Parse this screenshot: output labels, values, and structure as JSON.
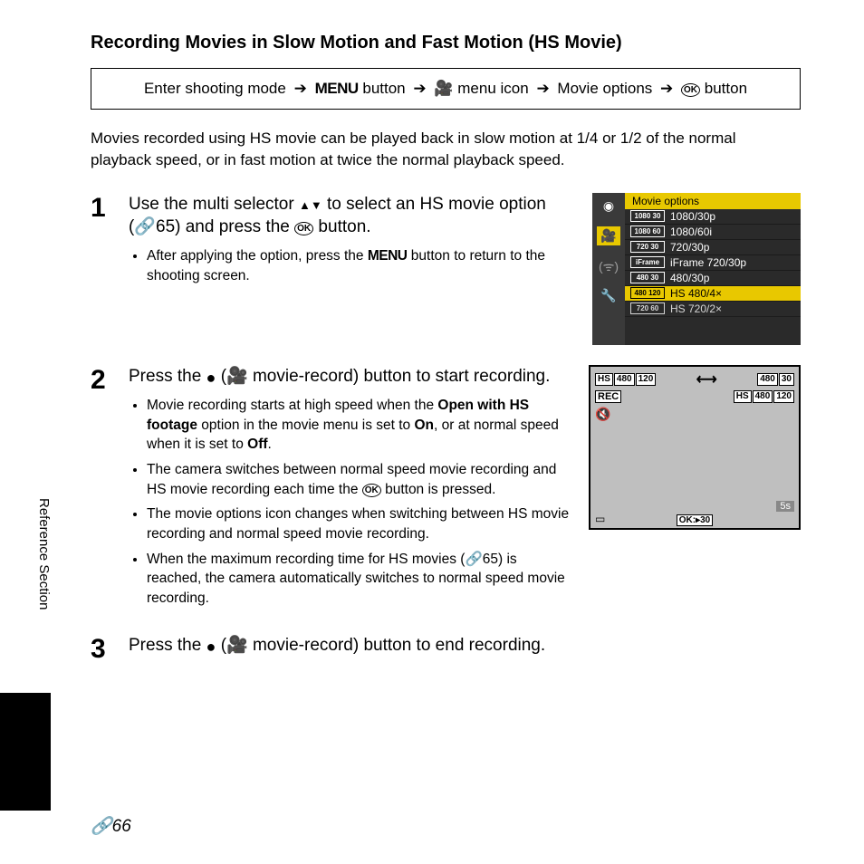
{
  "title": "Recording Movies in Slow Motion and Fast Motion (HS Movie)",
  "nav": {
    "p1": "Enter shooting mode",
    "p2": "MENU",
    "p3_suffix": "button",
    "p4_suffix": "menu icon",
    "p5": "Movie options",
    "p6_suffix": "button"
  },
  "intro": "Movies recorded using HS movie can be played back in slow motion at 1/4 or 1/2 of the normal playback speed, or in fast motion at twice the normal playback speed.",
  "steps": {
    "s1": {
      "num": "1",
      "head_a": "Use the multi selector ",
      "head_b": " to select an HS movie option (",
      "head_c": "65) and press the ",
      "head_d": " button.",
      "bullet1_a": "After applying the option, press the ",
      "bullet1_b": " button to return to the shooting screen."
    },
    "s2": {
      "num": "2",
      "head_a": "Press the ",
      "head_b": " movie-record) button to start recording.",
      "b1_a": "Movie recording starts at high speed when the ",
      "b1_bold1": "Open with HS footage",
      "b1_b": " option in the movie menu is set to ",
      "b1_bold2": "On",
      "b1_c": ", or at normal speed when it is set to ",
      "b1_bold3": "Off",
      "b1_d": ".",
      "b2_a": "The camera switches between normal speed movie recording and HS movie recording each time the ",
      "b2_b": " button is pressed.",
      "b3": "The movie options icon changes when switching between HS movie recording and normal speed movie recording.",
      "b4_a": "When the maximum recording time for HS movies (",
      "b4_b": "65) is reached, the camera automatically switches to normal speed movie recording."
    },
    "s3": {
      "num": "3",
      "head_a": "Press the ",
      "head_b": " movie-record) button to end recording."
    }
  },
  "lcd": {
    "header": "Movie options",
    "items": [
      "1080/30p",
      "1080/60i",
      "720/30p",
      "iFrame 720/30p",
      "480/30p",
      "HS 480/4×",
      "HS 720/2×"
    ],
    "chips": [
      "1080 30",
      "1080 60",
      "720 30",
      "iFrame",
      "480 30",
      "480 120",
      "720 60"
    ]
  },
  "rec": {
    "left_badge": {
      "hs": "HS",
      "res": "480",
      "fps": "120"
    },
    "right_badge": {
      "res": "480",
      "fps": "30"
    },
    "corner_badge": {
      "hs": "HS",
      "res": "480",
      "fps": "120"
    },
    "rec": "REC",
    "time": "5s",
    "ok_label": "30"
  },
  "side_label": "Reference Section",
  "page_num": "66",
  "chart_data": null
}
